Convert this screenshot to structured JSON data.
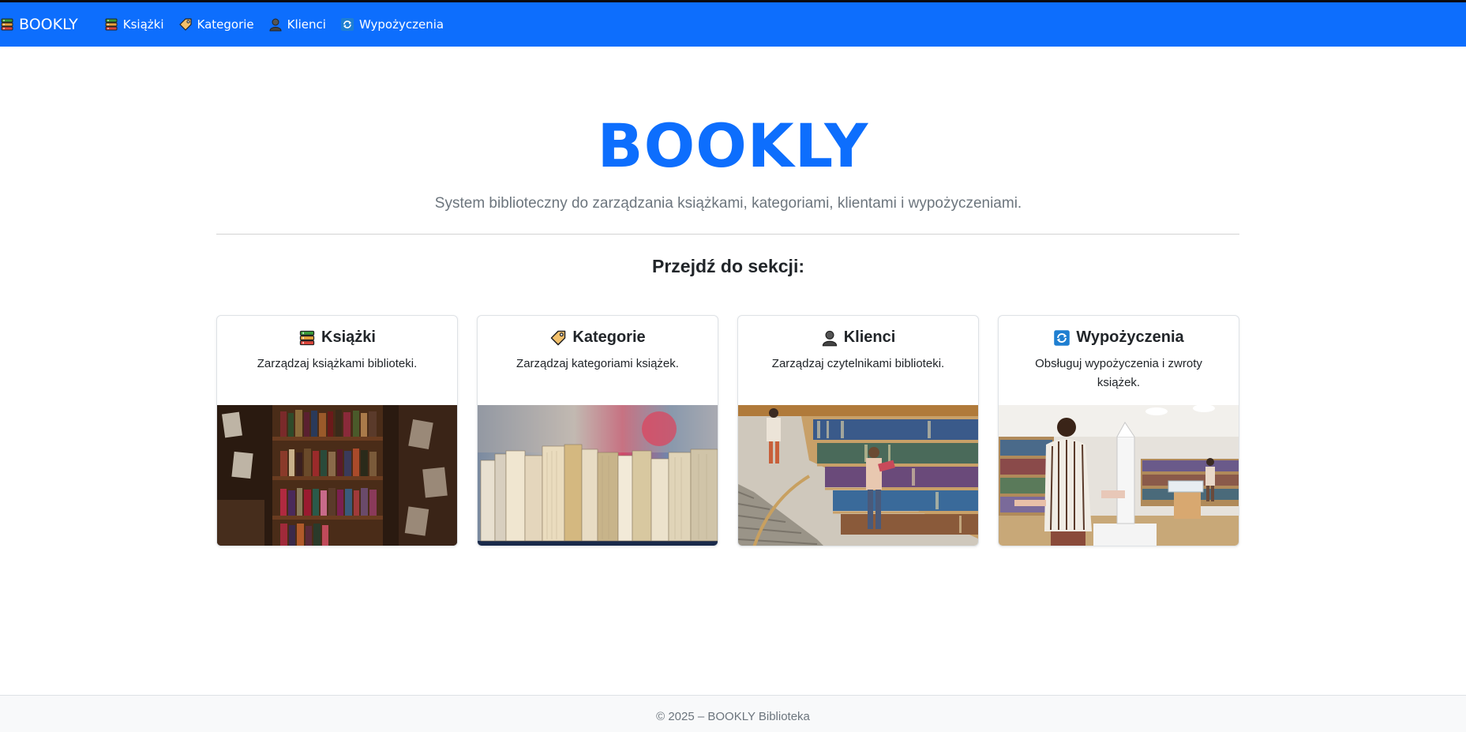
{
  "navbar": {
    "brand": "BOOKLY",
    "brand_icon": "books-icon",
    "links": [
      {
        "label": "Książki",
        "icon": "books-icon"
      },
      {
        "label": "Kategorie",
        "icon": "tag-icon"
      },
      {
        "label": "Klienci",
        "icon": "person-icon"
      },
      {
        "label": "Wypożyczenia",
        "icon": "refresh-icon"
      }
    ],
    "bg_color": "#0d6efd"
  },
  "hero": {
    "title": "BOOKLY",
    "subtitle": "System biblioteczny do zarządzania książkami, kategoriami, klientami i wypożyczeniami."
  },
  "section": {
    "title": "Przejdź do sekcji:"
  },
  "cards": [
    {
      "title": "Książki",
      "text": "Zarządzaj książkami biblioteki.",
      "icon": "books-icon",
      "image": "bookshelf-photo"
    },
    {
      "title": "Kategorie",
      "text": "Zarządzaj kategoriami książek.",
      "icon": "tag-icon",
      "image": "book-spines-photo"
    },
    {
      "title": "Klienci",
      "text": "Zarządzaj czytelnikami biblioteki.",
      "icon": "person-icon",
      "image": "library-readers-photo"
    },
    {
      "title": "Wypożyczenia",
      "text": "Obsługuj wypożyczenia i zwroty książek.",
      "icon": "refresh-icon",
      "image": "library-desk-photo"
    }
  ],
  "footer": {
    "text": "© 2025 – BOOKLY Biblioteka"
  }
}
